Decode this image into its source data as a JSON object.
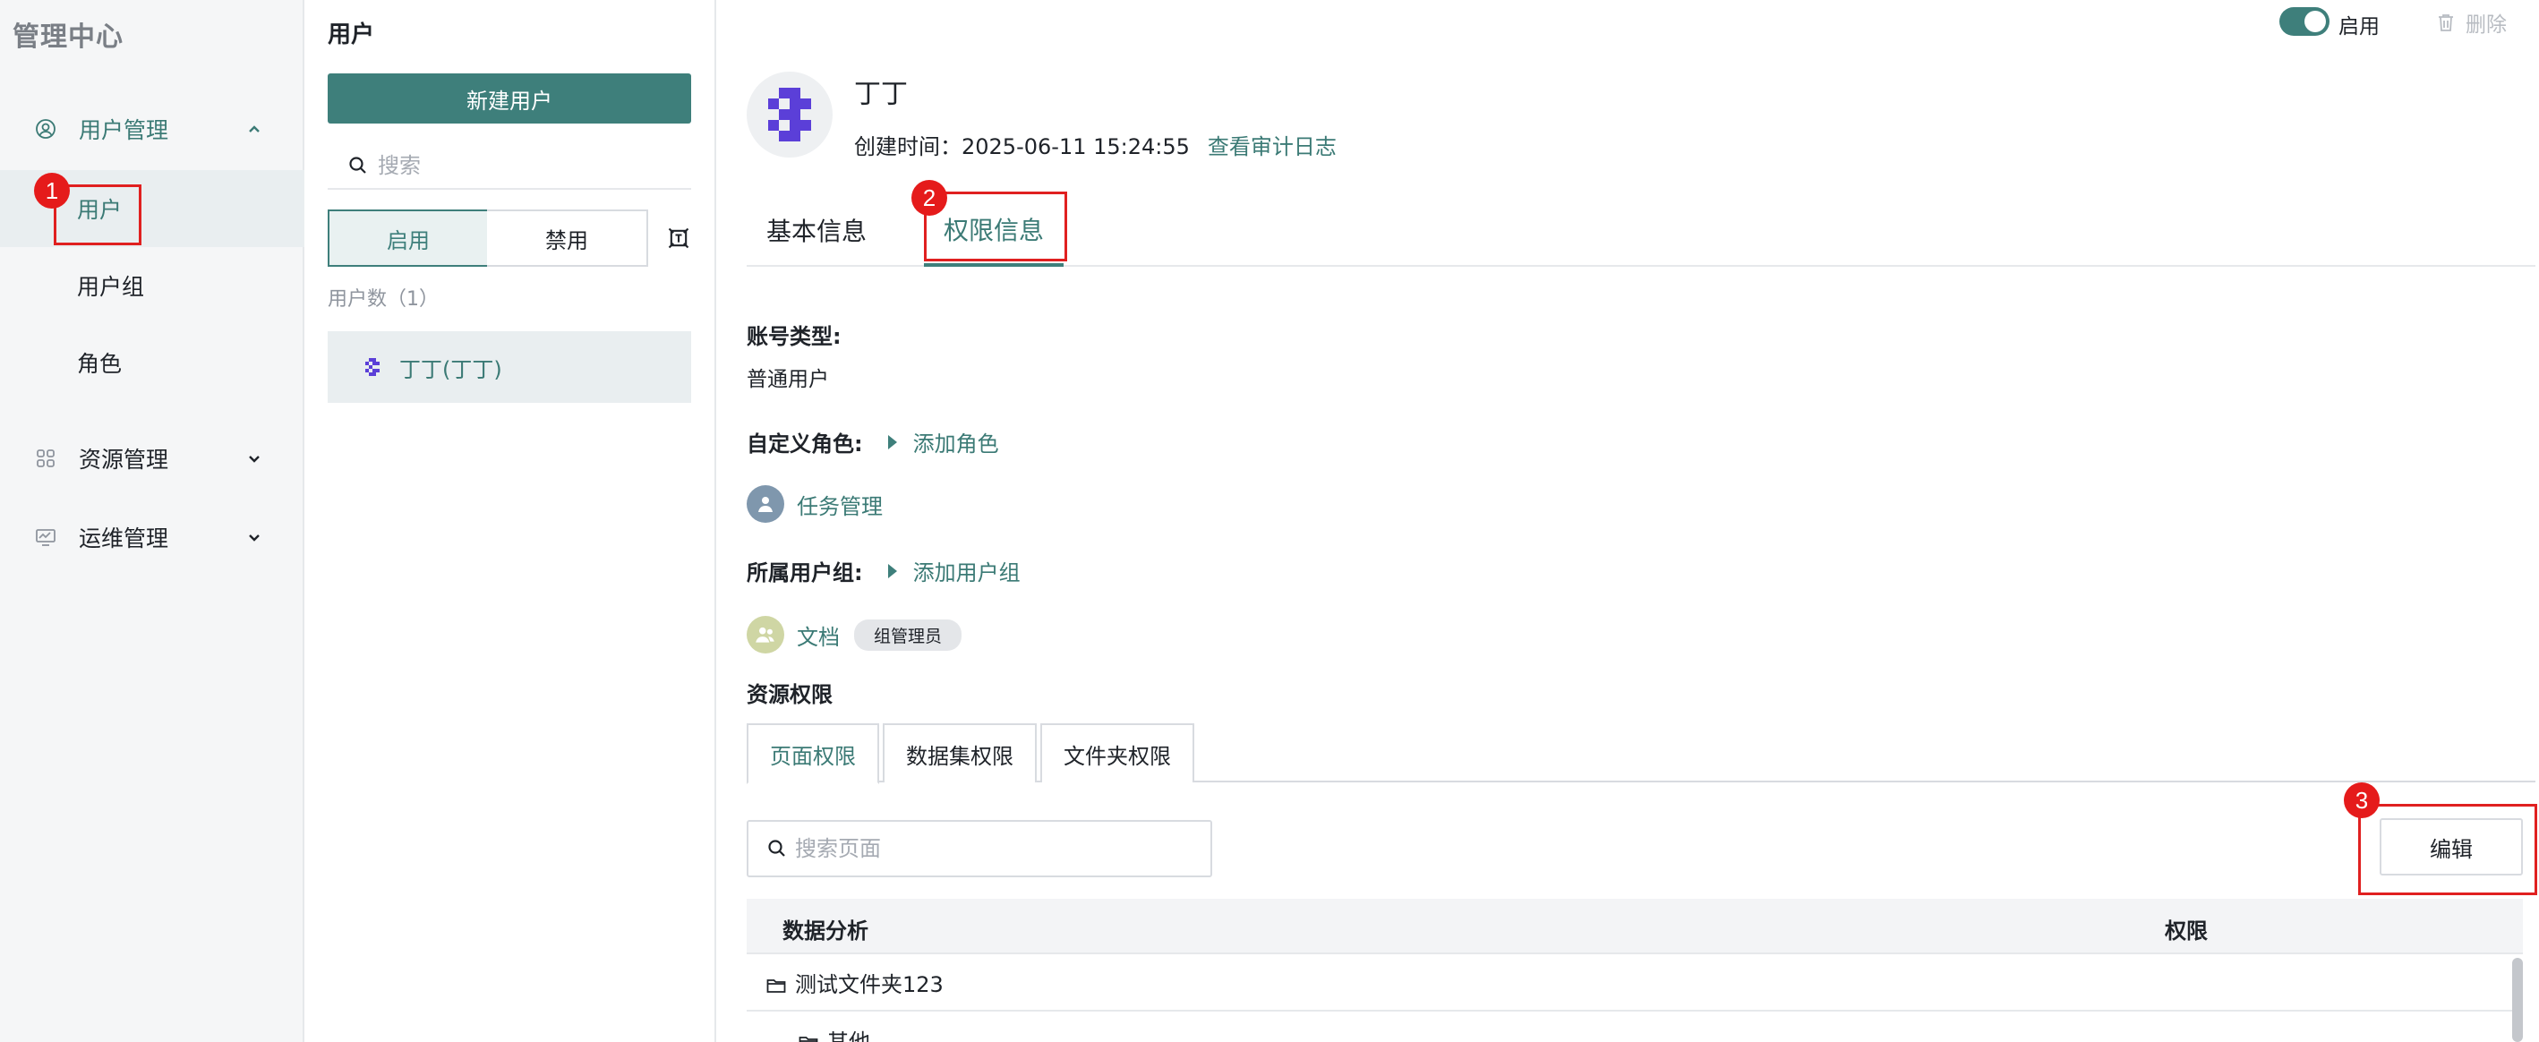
{
  "app_title": "管理中心",
  "sidebar": {
    "groups": [
      {
        "label": "用户管理",
        "icon": "user-circle-icon",
        "expanded": true
      },
      {
        "label": "资源管理",
        "icon": "grid-icon",
        "expanded": false
      },
      {
        "label": "运维管理",
        "icon": "monitor-icon",
        "expanded": false
      }
    ],
    "sub_items": [
      {
        "label": "用户",
        "selected": true
      },
      {
        "label": "用户组",
        "selected": false
      },
      {
        "label": "角色",
        "selected": false
      }
    ]
  },
  "users_panel": {
    "title": "用户",
    "new_button": "新建用户",
    "search_placeholder": "搜索",
    "filter_enabled": "启用",
    "filter_disabled": "禁用",
    "count_label": "用户数（1）",
    "users": [
      {
        "name": "丁丁(丁丁)"
      }
    ]
  },
  "detail": {
    "status_toggle_label": "启用",
    "status_on": true,
    "delete_label": "删除",
    "name": "丁丁",
    "created_label": "创建时间：",
    "created_value": "2025-06-11 15:24:55",
    "audit_link": "查看审计日志",
    "tabs": [
      {
        "label": "基本信息",
        "active": false
      },
      {
        "label": "权限信息",
        "active": true
      }
    ],
    "account_type_label": "账号类型:",
    "account_type_value": "普通用户",
    "custom_role_label": "自定义角色:",
    "add_role": "添加角色",
    "roles": [
      {
        "name": "任务管理"
      }
    ],
    "group_label": "所属用户组:",
    "add_group": "添加用户组",
    "groups": [
      {
        "name": "文档",
        "badge": "组管理员"
      }
    ],
    "resource_perm_label": "资源权限",
    "resource_tabs": [
      {
        "label": "页面权限",
        "active": true
      },
      {
        "label": "数据集权限",
        "active": false
      },
      {
        "label": "文件夹权限",
        "active": false
      }
    ],
    "page_search_placeholder": "搜索页面",
    "edit_button": "编辑",
    "table": {
      "columns": [
        "数据分析",
        "权限"
      ],
      "rows": [
        {
          "name": "测试文件夹123",
          "level": 0,
          "icon": "folder-icon"
        },
        {
          "name": "其他",
          "level": 1,
          "icon": "folder-icon"
        }
      ]
    }
  },
  "annotations": [
    "1",
    "2",
    "3"
  ],
  "colors": {
    "accent": "#3e7f7b",
    "annotation_red": "#e51b1b",
    "sidebar_bg": "#f5f6f7",
    "selected_bg": "#e9eef0"
  }
}
